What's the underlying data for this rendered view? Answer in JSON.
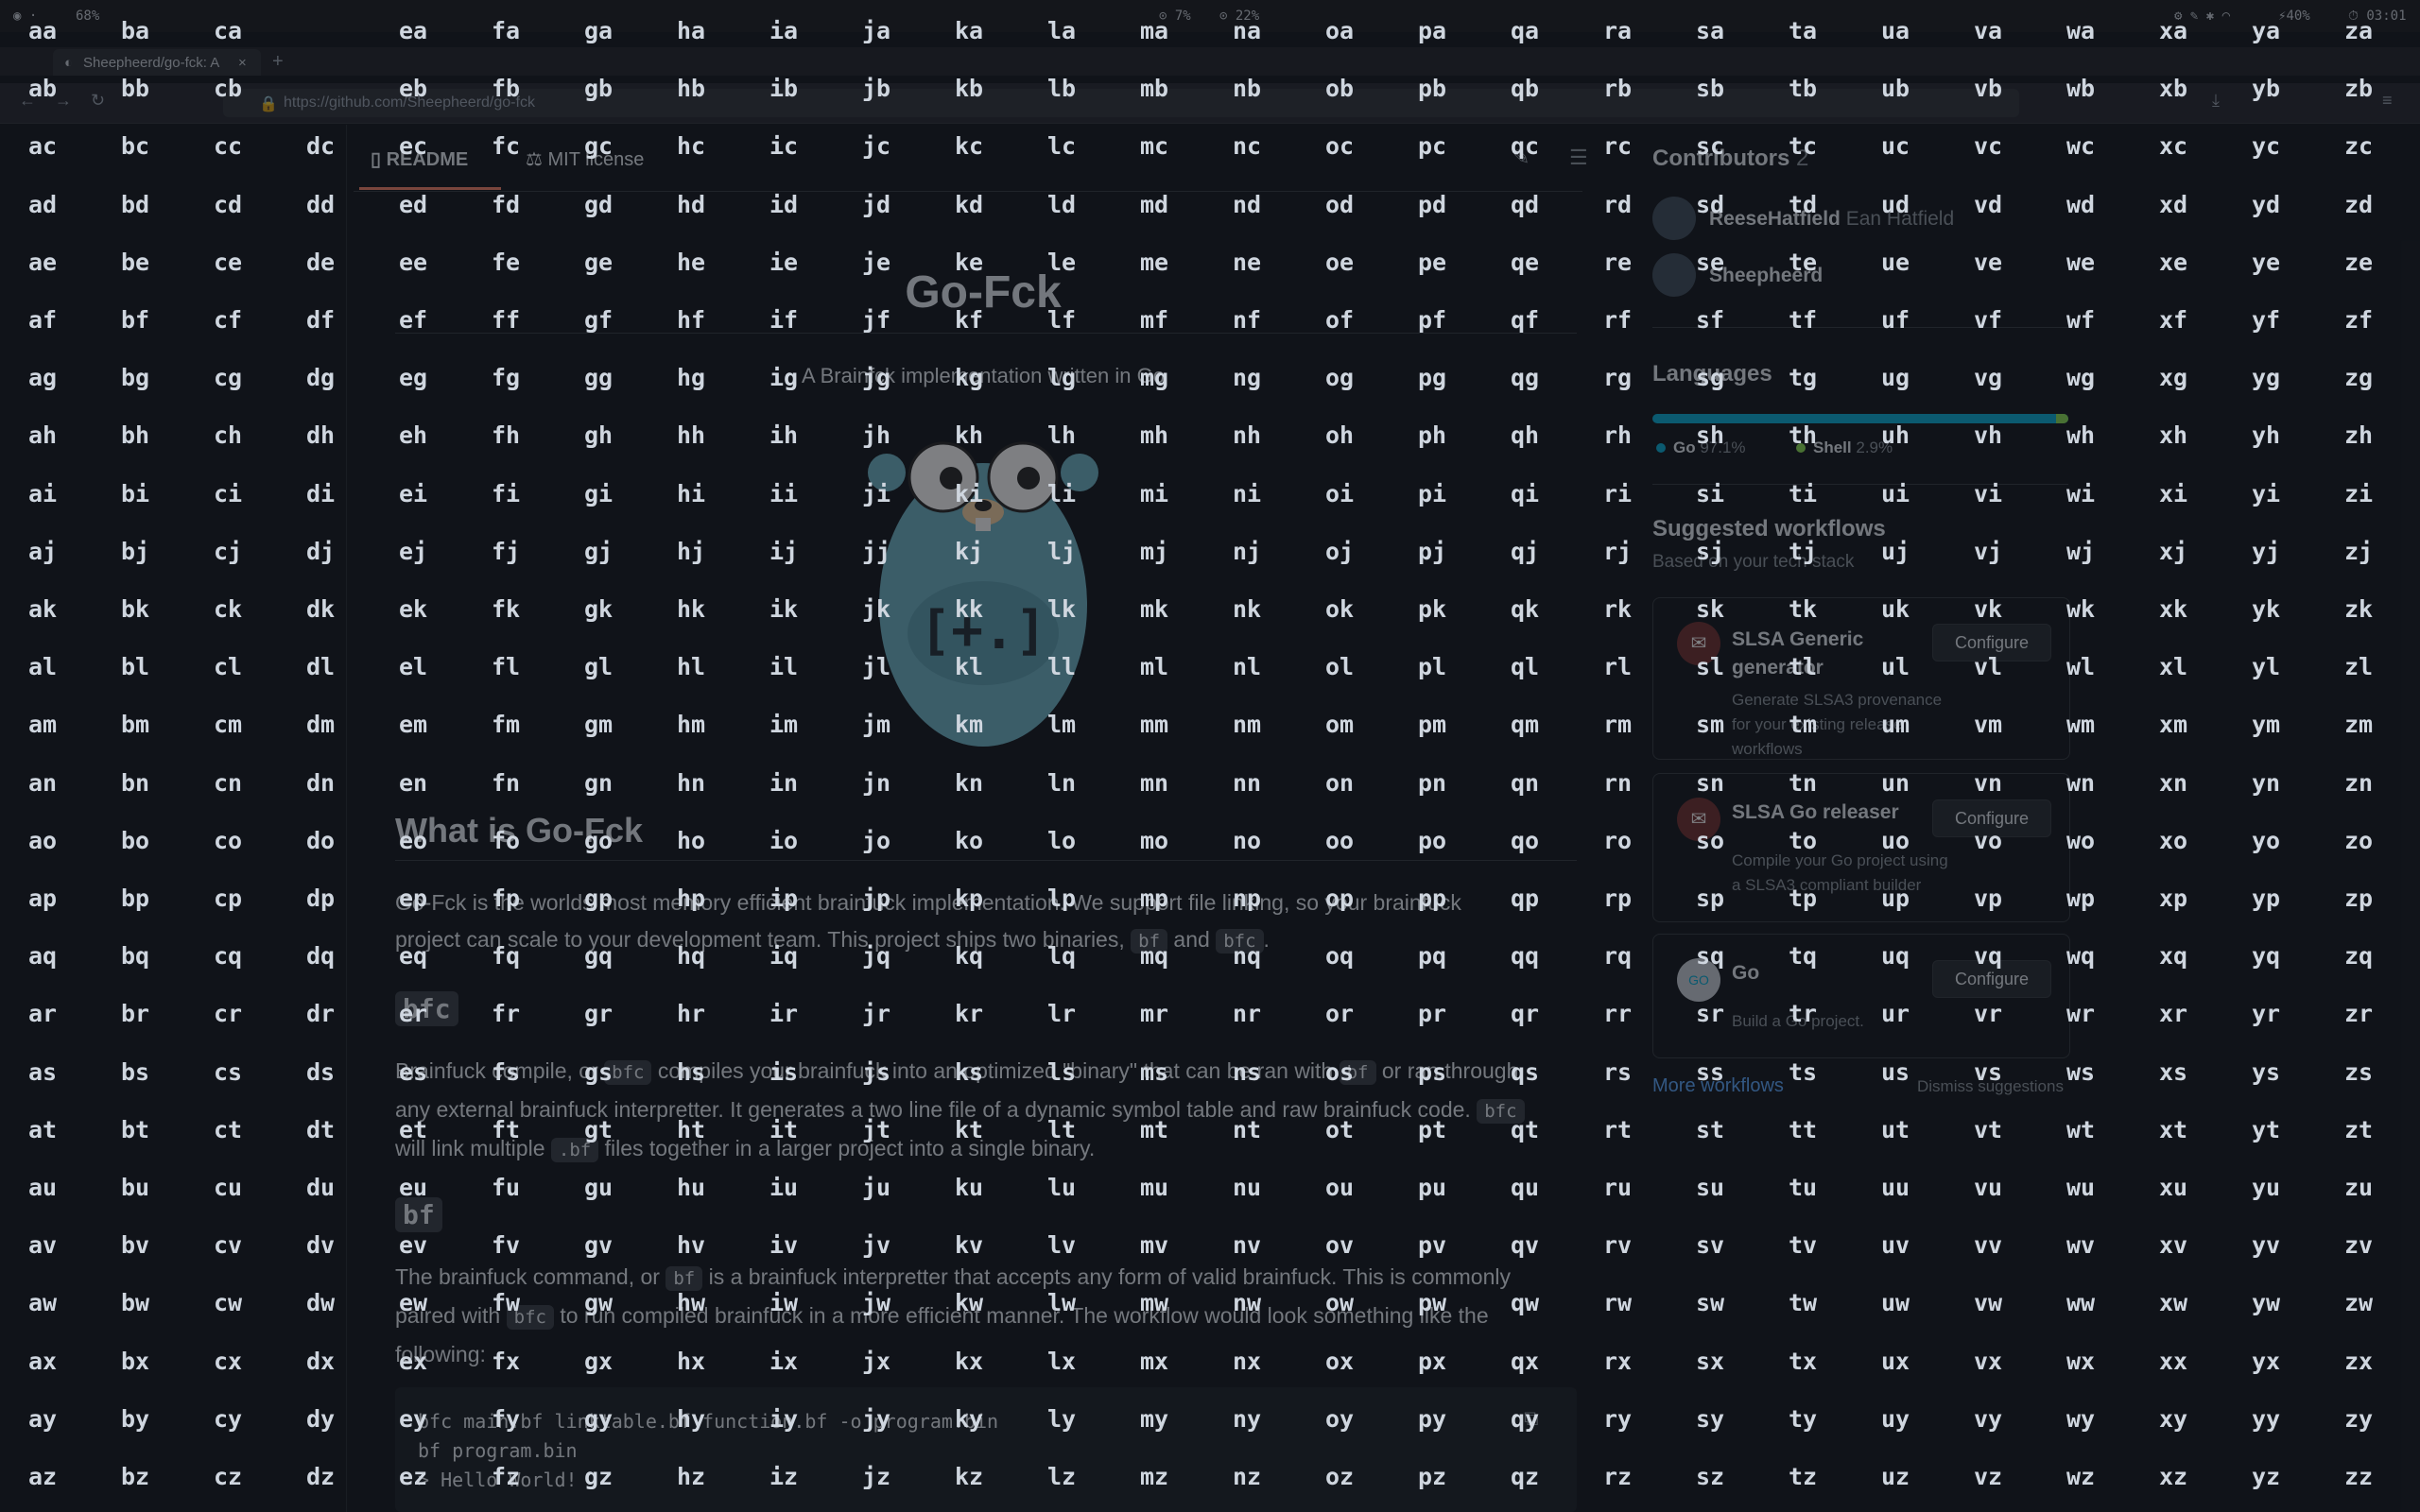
{
  "statusbar": {
    "zoom": "68%",
    "cpu": "7%",
    "mem": "22%",
    "battery": "40%",
    "time": "03:01"
  },
  "browser": {
    "tab_title": "Sheepheerd/go-fck: A",
    "url": "https://github.com/Sheepheerd/go-fck"
  },
  "readme": {
    "tabs": [
      "README",
      "MIT license"
    ],
    "title": "Go-Fck",
    "subtitle": "A Brainfck implementation written in Go",
    "gopher_text": "[+.]",
    "what_heading": "What is Go-Fck",
    "what_para": [
      "Go-Fck is the worlds most memory efficient brainfuck implementation. We support file linking, so your brainfuck",
      "project can scale to your development team. This project ships two binaries,",
      "bf",
      "and",
      "bfc",
      "."
    ],
    "bfc_heading": "bfc",
    "bfc_para": [
      "Brainfuck compile, or",
      "bfc",
      "compiles your brainfuck into an optimized \"binary\" that can be ran with",
      "bf",
      "or ran through",
      "any external brainfuck interpretter. It generates a two line file of a dynamic symbol table and raw brainfuck code.",
      "bfc",
      "will link multiple",
      ".bf",
      "files together in a larger project into a single binary."
    ],
    "bf_heading": "bf",
    "bf_para": [
      "The brainfuck command, or",
      "bf",
      "is a brainfuck interpretter that accepts any form of valid brainfuck. This is commonly",
      "paired with",
      "bfc",
      "to run compiled brainfuck in a more efficient manner. The workflow would look something like the",
      "following:"
    ],
    "code": [
      "bfc main.bf linktable.bf function.bf -o program.bin",
      "bf program.bin",
      "> Hello World!"
    ]
  },
  "sidebar": {
    "contributors_heading": "Contributors",
    "contributors_count": "2",
    "contributors": [
      {
        "login": "ReeseHatfield",
        "name": "Ean Hatfield"
      },
      {
        "login": "Sheepheerd",
        "name": ""
      }
    ],
    "languages_heading": "Languages",
    "languages": [
      {
        "name": "Go",
        "pct": "97.1%",
        "color": "#00add8"
      },
      {
        "name": "Shell",
        "pct": "2.9%",
        "color": "#89e051"
      }
    ],
    "workflows_heading": "Suggested workflows",
    "workflows_sub": "Based on your tech stack",
    "workflows": [
      {
        "title": "SLSA Generic generator",
        "desc": "Generate SLSA3 provenance for your existing release workflows",
        "button": "Configure"
      },
      {
        "title": "SLSA Go releaser",
        "desc": "Compile your Go project using a SLSA3 compliant builder",
        "button": "Configure"
      },
      {
        "title": "Go",
        "desc": "Build a Go project.",
        "button": "Configure"
      }
    ],
    "more_workflows": "More workflows",
    "dismiss": "Dismiss suggestions"
  },
  "hints": {
    "prefixes": [
      "a",
      "b",
      "c",
      "d",
      "e",
      "f",
      "g",
      "h",
      "i",
      "j",
      "k",
      "l",
      "m",
      "n",
      "o",
      "p",
      "q",
      "r",
      "s",
      "t",
      "u",
      "v",
      "w",
      "x",
      "y",
      "z"
    ],
    "suffixes": [
      "a",
      "b",
      "c",
      "d",
      "e",
      "f",
      "g",
      "h",
      "i",
      "j",
      "k",
      "l",
      "m",
      "n",
      "o",
      "p",
      "q",
      "r",
      "s",
      "t",
      "u",
      "v",
      "w",
      "x",
      "y",
      "z"
    ]
  }
}
